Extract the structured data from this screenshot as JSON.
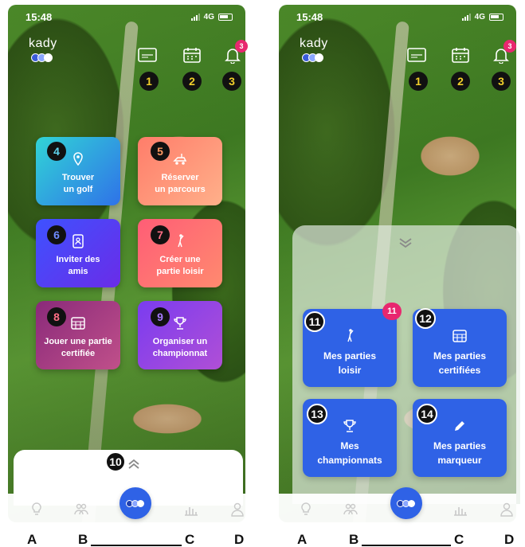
{
  "status": {
    "time": "15:48",
    "network": "4G"
  },
  "app": {
    "logo": "kady"
  },
  "top_icons": {
    "bell_badge": "3"
  },
  "markers": [
    "1",
    "2",
    "3",
    "4",
    "5",
    "6",
    "7",
    "8",
    "9",
    "10",
    "11",
    "12",
    "13",
    "14"
  ],
  "menu": {
    "find_golf": {
      "line1": "Trouver",
      "line2": "un golf"
    },
    "book_course": {
      "line1": "Réserver",
      "line2": "un parcours"
    },
    "invite": {
      "line1": "Inviter des",
      "line2": "amis"
    },
    "create_leisure": {
      "line1": "Créer une",
      "line2": "partie loisir"
    },
    "certified_game": {
      "line1": "Jouer une partie",
      "line2": "certifiée"
    },
    "championship": {
      "line1": "Organiser un",
      "line2": "championnat"
    }
  },
  "games_sheet": {
    "leisure": {
      "line1": "Mes parties",
      "line2": "loisir",
      "badge": "11"
    },
    "certified": {
      "line1": "Mes parties",
      "line2": "certifiées"
    },
    "championships": {
      "line1": "Mes",
      "line2": "championnats"
    },
    "scorer": {
      "line1": "Mes parties",
      "line2": "marqueur"
    }
  },
  "nav_letters": [
    "A",
    "B",
    "C",
    "D"
  ],
  "colors": {
    "accent_blue": "#2f62e6",
    "badge_pink": "#e8276f",
    "marker_yellow": "#f2d02b"
  }
}
